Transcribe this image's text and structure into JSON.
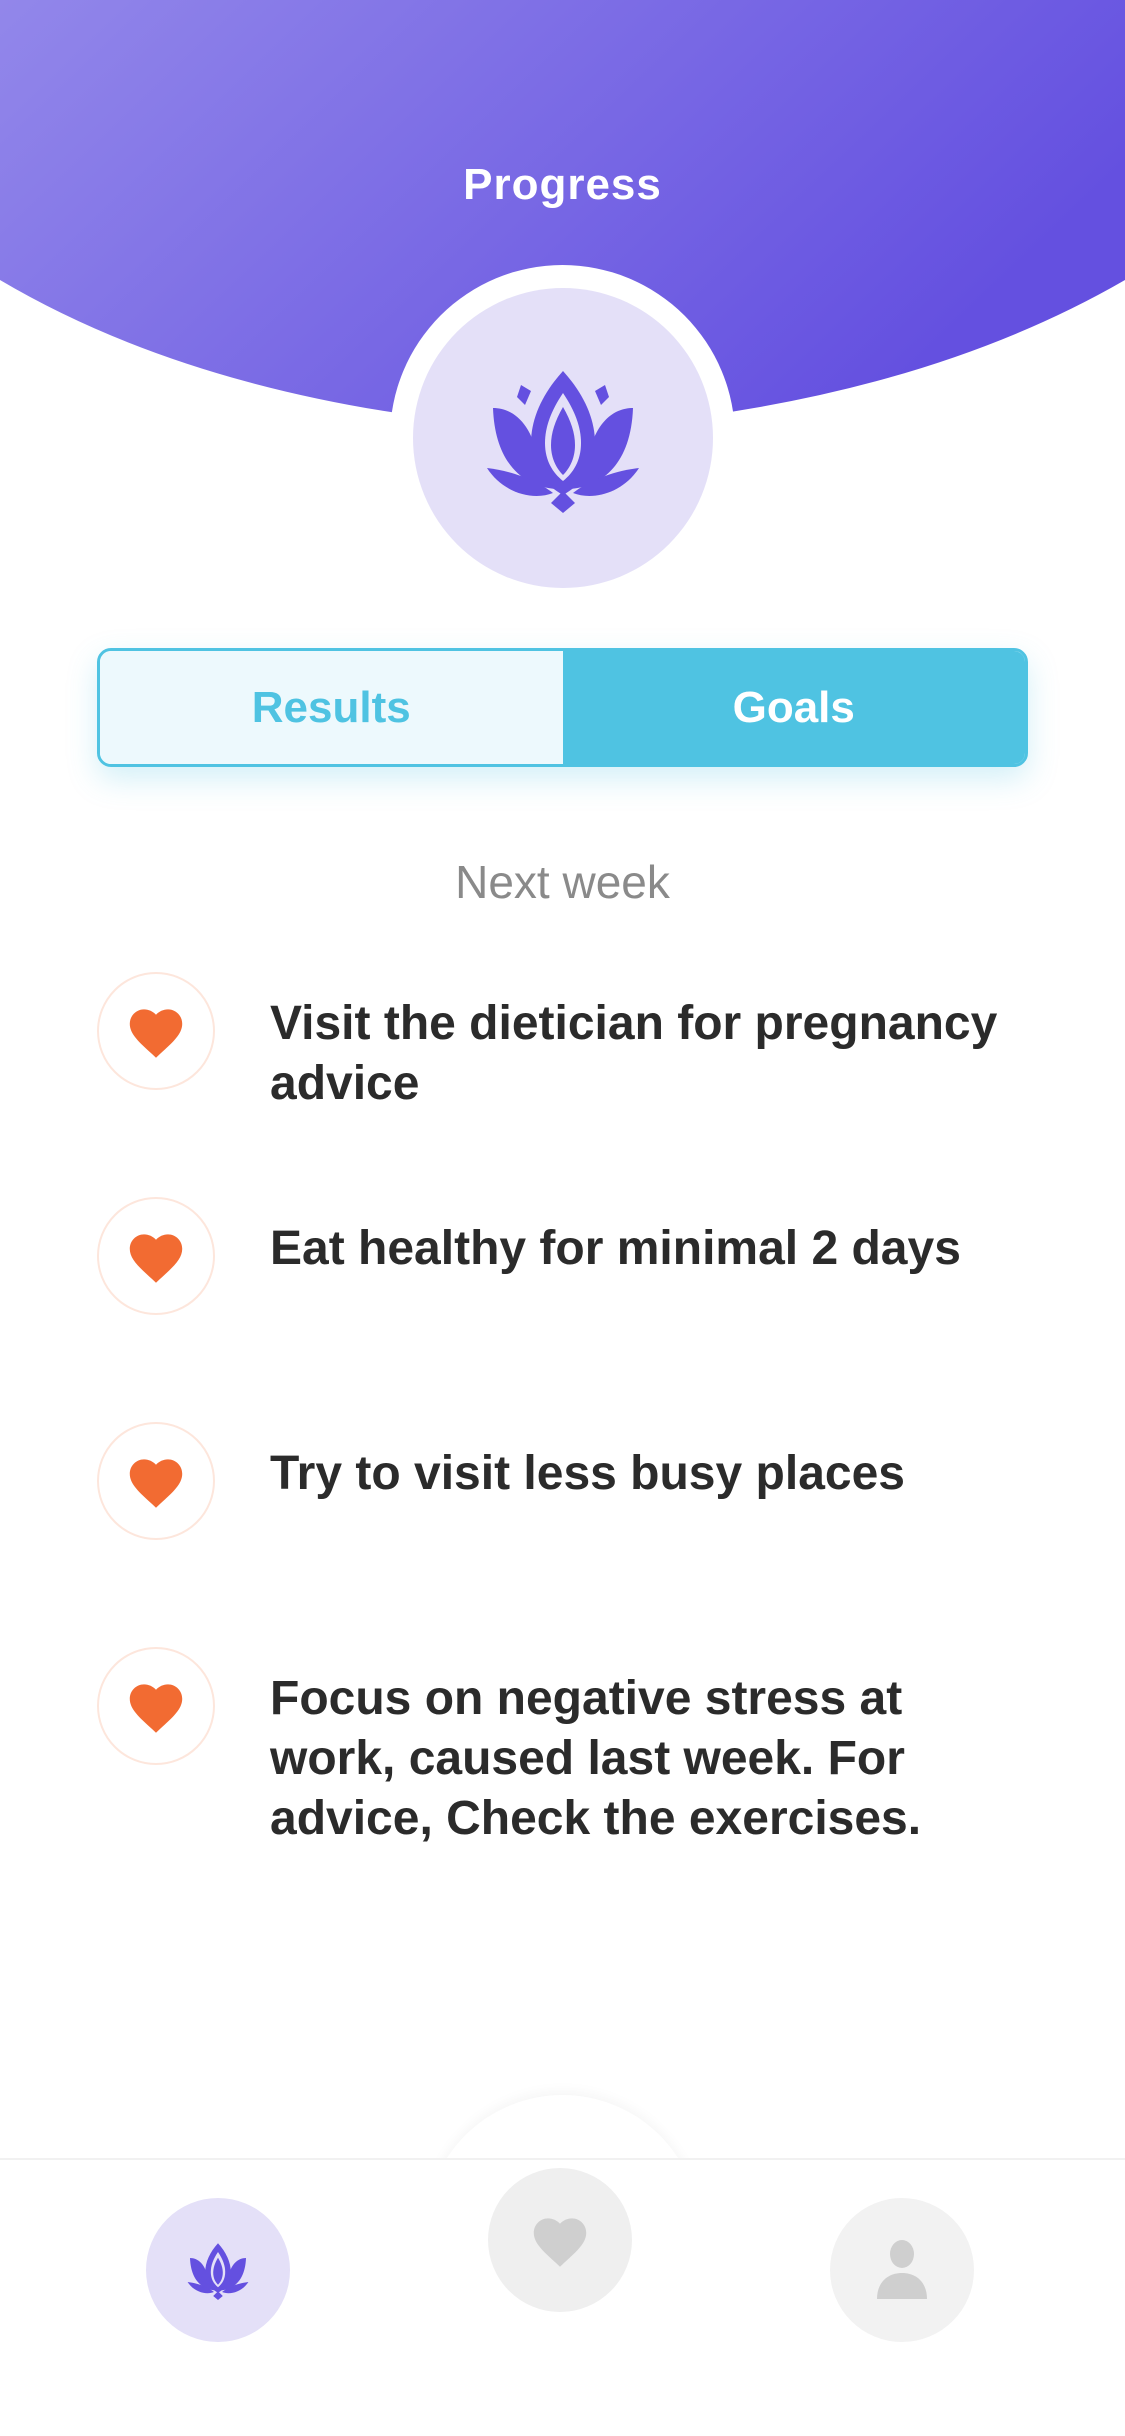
{
  "header": {
    "title": "Progress",
    "logo_icon": "lotus-icon",
    "colors": {
      "gradient_start": "#9287ea",
      "gradient_end": "#6450e0"
    }
  },
  "segmented": {
    "options": [
      "Results",
      "Goals"
    ],
    "selected": "Goals",
    "accent": "#4fc3e2"
  },
  "goals": {
    "section_title": "Next week",
    "icon": "heart-icon",
    "icon_color": "#f26b32",
    "items": [
      {
        "text": "Visit the dietician for pregnancy advice"
      },
      {
        "text": "Eat healthy for minimal 2 days"
      },
      {
        "text": "Try to visit less busy places"
      },
      {
        "text": "Focus on negative stress at work, caused last week. For advice, Check the exercises."
      }
    ]
  },
  "tabbar": {
    "items": [
      {
        "icon": "lotus-icon",
        "active": true
      },
      {
        "icon": "heart-icon",
        "active": false
      },
      {
        "icon": "profile-icon",
        "active": false
      }
    ]
  }
}
